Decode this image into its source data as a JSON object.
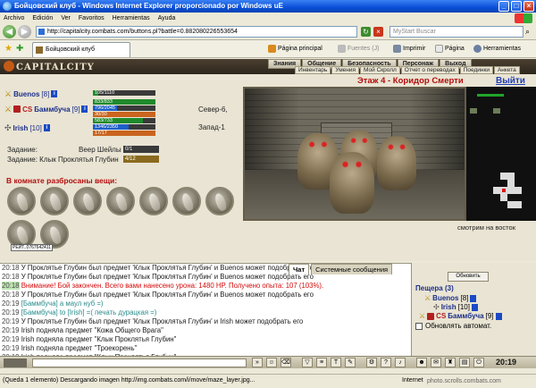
{
  "window": {
    "title": "Бойцовский клуб - Windows Internet Explorer proporcionado por Windows uE"
  },
  "menu": [
    "Archivo",
    "Edición",
    "Ver",
    "Favoritos",
    "Herramientas",
    "Ayuda"
  ],
  "address": {
    "url": "http://capitalcity.combats.com/buttons.pl?battle=0.882080226553654",
    "search_placeholder": "MyStart Buscar"
  },
  "toolbar": {
    "tab_title": "Бойцовский клуб",
    "home": "Página principal",
    "feeds": "Fuentes (J)",
    "print": "Imprimir",
    "page": "Página",
    "tools": "Herramientas"
  },
  "site": {
    "logo": "CAPITALCITY",
    "nav": [
      "Знания",
      "Общение",
      "Безопасность",
      "Персонаж",
      "Выход"
    ],
    "subnav": [
      "Инвентарь",
      "Умения",
      "Мой Скролл",
      "Отчет о переводах",
      "Поединки",
      "Анкета"
    ]
  },
  "battle": {
    "title": "Этаж 4 - Коридор Смерти",
    "exit": "Выйти"
  },
  "players": [
    {
      "name": "Buenos",
      "level": "[8]",
      "hp": "105/1110",
      "hp_frac": 0.09
    },
    {
      "clan": "CS",
      "name": "Баммбуча",
      "level": "[9]",
      "bars": [
        {
          "text": "833/833",
          "color": "#1f8a2c",
          "frac": 1.0
        },
        {
          "text": "796/2045",
          "color": "#1f5fc8",
          "frac": 0.39
        },
        {
          "text": "30/30",
          "color": "#c9651e",
          "frac": 1.0
        },
        {
          "text": "583/733",
          "color": "#1f8a2c",
          "frac": 0.8
        },
        {
          "text": "1346/2350",
          "color": "#1f5fc8",
          "frac": 0.57
        },
        {
          "text": "17/17",
          "color": "#c9651e",
          "frac": 1.0
        }
      ]
    },
    {
      "name": "Irish",
      "level": "[10]"
    }
  ],
  "locations": [
    "Севeр-6,",
    "Запад-1"
  ],
  "quests": {
    "label": "Задание:",
    "items": [
      {
        "label": "Задание:",
        "text": "Веер Шейлы",
        "progress": "0/1"
      },
      {
        "label": "Задание: Клык Проклятья Глубин",
        "text": "",
        "progress": "4/12"
      }
    ]
  },
  "items_title": "В комнате разбросаны вещи:",
  "item_tooltip": "РЕЙТ..0767642411",
  "map_caption": "смотрим на восток",
  "chat": {
    "tabs": [
      "Чат",
      "Системные сообщения"
    ],
    "lines": [
      {
        "ts": "20:18",
        "text": "У Проклятье Глубин был предмет 'Клык Проклятья Глубин' и Buenos может подобрать его"
      },
      {
        "ts": "20:18",
        "text": "У Проклятье Глубин был предмет 'Клык Проклятья Глубин' и Buenos может подобрать его"
      },
      {
        "ts": "20:18",
        "text": "Внимание! Бой закончен. Всего вами нанесено урона: 1480 HP. Получено опыта: 107 (103%).",
        "style": "warn"
      },
      {
        "ts": "20:18",
        "text": "У Проклятье Глубин был предмет 'Клык Проклятья Глубин' и Buenos может подобрать его"
      },
      {
        "ts": "20:19",
        "text": "[Баммбуча] а маул нуб =)",
        "style": "priv"
      },
      {
        "ts": "20:19",
        "text": "[Баммбуча] to [Irish] =( печать дурацкая =)",
        "style": "priv"
      },
      {
        "ts": "20:19",
        "text": "У Проклятье Глубин был предмет 'Клык Проклятья Глубин' и Irish может подобрать его"
      },
      {
        "ts": "20:19",
        "text": "Irish подняла предмет \"Кожа Общего Врага\""
      },
      {
        "ts": "20:19",
        "text": "Irish подняла предмет \"Клык Проклятья Глубин\""
      },
      {
        "ts": "20:19",
        "text": "Irish подняла предмет \"Троекорень\""
      },
      {
        "ts": "20:19",
        "text": "Irish подняла предмет \"Клык Проклятья Глубин\""
      }
    ]
  },
  "side": {
    "refresh": "Обновить",
    "cave_title": "Пещера (3)",
    "players": [
      {
        "name": "Buenos",
        "level": "[8]"
      },
      {
        "name": "Irish",
        "level": "[10]"
      },
      {
        "clan": "CS",
        "name": "Баммбуча",
        "level": "[9]"
      }
    ],
    "auto_refresh": "Обновлять автомат."
  },
  "clock": "20:19",
  "status": {
    "text": "(Queda 1 elemento) Descargando imagen http://img.combats.com/i/move/maze_layer.jpg...",
    "zone": "Internet",
    "watermark": "photo.scrolls.combats.com"
  }
}
